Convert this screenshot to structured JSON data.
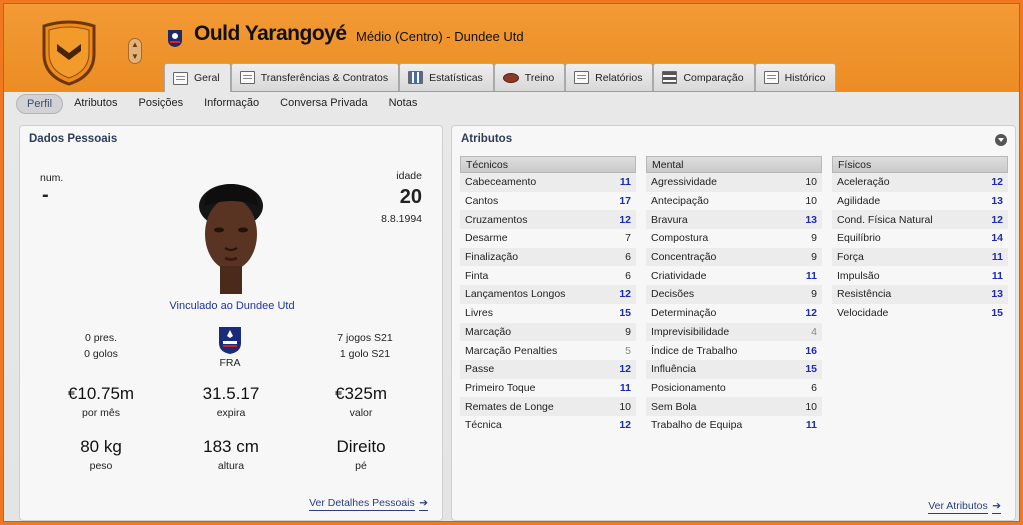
{
  "header": {
    "player_name": "Ould Yarangoyé",
    "position_club": "Médio (Centro) - Dundee Utd",
    "arrow_up": "▲",
    "arrow_down": "▼"
  },
  "tabs": [
    {
      "label": "Geral",
      "icon": "profile-card-icon",
      "active": true
    },
    {
      "label": "Transferências & Contratos",
      "icon": "document-icon"
    },
    {
      "label": "Estatísticas",
      "icon": "bar-chart-icon"
    },
    {
      "label": "Treino",
      "icon": "rugby-ball-icon"
    },
    {
      "label": "Relatórios",
      "icon": "report-icon"
    },
    {
      "label": "Comparação",
      "icon": "compare-icon"
    },
    {
      "label": "Histórico",
      "icon": "history-icon"
    }
  ],
  "subnav": [
    "Perfil",
    "Atributos",
    "Posições",
    "Informação",
    "Conversa Privada",
    "Notas"
  ],
  "personal": {
    "title": "Dados Pessoais",
    "num_label": "num.",
    "num_value": "-",
    "age_label": "idade",
    "age_value": "20",
    "dob": "8.8.1994",
    "club_link": "Vinculado ao Dundee Utd",
    "left_stats": [
      "0 pres.",
      "0 golos"
    ],
    "right_stats": [
      "7 jogos S21",
      "1 golo S21"
    ],
    "nation": "FRA",
    "row1": [
      {
        "value": "€10.75m",
        "label": "por mês"
      },
      {
        "value": "31.5.17",
        "label": "expira"
      },
      {
        "value": "€325m",
        "label": "valor"
      }
    ],
    "row2": [
      {
        "value": "80 kg",
        "label": "peso"
      },
      {
        "value": "183 cm",
        "label": "altura"
      },
      {
        "value": "Direito",
        "label": "pé"
      }
    ],
    "more_link": "Ver Detalhes Pessoais"
  },
  "attributes": {
    "title": "Atributos",
    "more_link": "Ver Atributos",
    "columns": [
      {
        "header": "Técnicos",
        "rows": [
          {
            "name": "Cabeceamento",
            "value": "11",
            "tone": "blue"
          },
          {
            "name": "Cantos",
            "value": "17",
            "tone": "blue"
          },
          {
            "name": "Cruzamentos",
            "value": "12",
            "tone": "blue"
          },
          {
            "name": "Desarme",
            "value": "7",
            "tone": "dark"
          },
          {
            "name": "Finalização",
            "value": "6",
            "tone": "dark"
          },
          {
            "name": "Finta",
            "value": "6",
            "tone": "dark"
          },
          {
            "name": "Lançamentos Longos",
            "value": "12",
            "tone": "blue"
          },
          {
            "name": "Livres",
            "value": "15",
            "tone": "blue"
          },
          {
            "name": "Marcação",
            "value": "9",
            "tone": "dark"
          },
          {
            "name": "Marcação Penalties",
            "value": "5",
            "tone": "grey"
          },
          {
            "name": "Passe",
            "value": "12",
            "tone": "blue"
          },
          {
            "name": "Primeiro Toque",
            "value": "11",
            "tone": "blue"
          },
          {
            "name": "Remates de Longe",
            "value": "10",
            "tone": "dark"
          },
          {
            "name": "Técnica",
            "value": "12",
            "tone": "blue"
          }
        ]
      },
      {
        "header": "Mental",
        "rows": [
          {
            "name": "Agressividade",
            "value": "10",
            "tone": "dark"
          },
          {
            "name": "Antecipação",
            "value": "10",
            "tone": "dark"
          },
          {
            "name": "Bravura",
            "value": "13",
            "tone": "blue"
          },
          {
            "name": "Compostura",
            "value": "9",
            "tone": "dark"
          },
          {
            "name": "Concentração",
            "value": "9",
            "tone": "dark"
          },
          {
            "name": "Criatividade",
            "value": "11",
            "tone": "blue"
          },
          {
            "name": "Decisões",
            "value": "9",
            "tone": "dark"
          },
          {
            "name": "Determinação",
            "value": "12",
            "tone": "blue"
          },
          {
            "name": "Imprevisibilidade",
            "value": "4",
            "tone": "grey"
          },
          {
            "name": "Índice de Trabalho",
            "value": "16",
            "tone": "blue"
          },
          {
            "name": "Influência",
            "value": "15",
            "tone": "blue"
          },
          {
            "name": "Posicionamento",
            "value": "6",
            "tone": "dark"
          },
          {
            "name": "Sem Bola",
            "value": "10",
            "tone": "dark"
          },
          {
            "name": "Trabalho de Equipa",
            "value": "11",
            "tone": "blue"
          }
        ]
      },
      {
        "header": "Físicos",
        "rows": [
          {
            "name": "Aceleração",
            "value": "12",
            "tone": "blue"
          },
          {
            "name": "Agilidade",
            "value": "13",
            "tone": "blue"
          },
          {
            "name": "Cond. Física Natural",
            "value": "12",
            "tone": "blue"
          },
          {
            "name": "Equilíbrio",
            "value": "14",
            "tone": "blue"
          },
          {
            "name": "Força",
            "value": "11",
            "tone": "blue"
          },
          {
            "name": "Impulsão",
            "value": "11",
            "tone": "blue"
          },
          {
            "name": "Resistência",
            "value": "13",
            "tone": "blue"
          },
          {
            "name": "Velocidade",
            "value": "15",
            "tone": "blue"
          }
        ]
      }
    ]
  },
  "colors": {
    "header_orange": "#ec8d24",
    "value_blue": "#1c2bb4",
    "link_blue": "#2a3c84"
  }
}
